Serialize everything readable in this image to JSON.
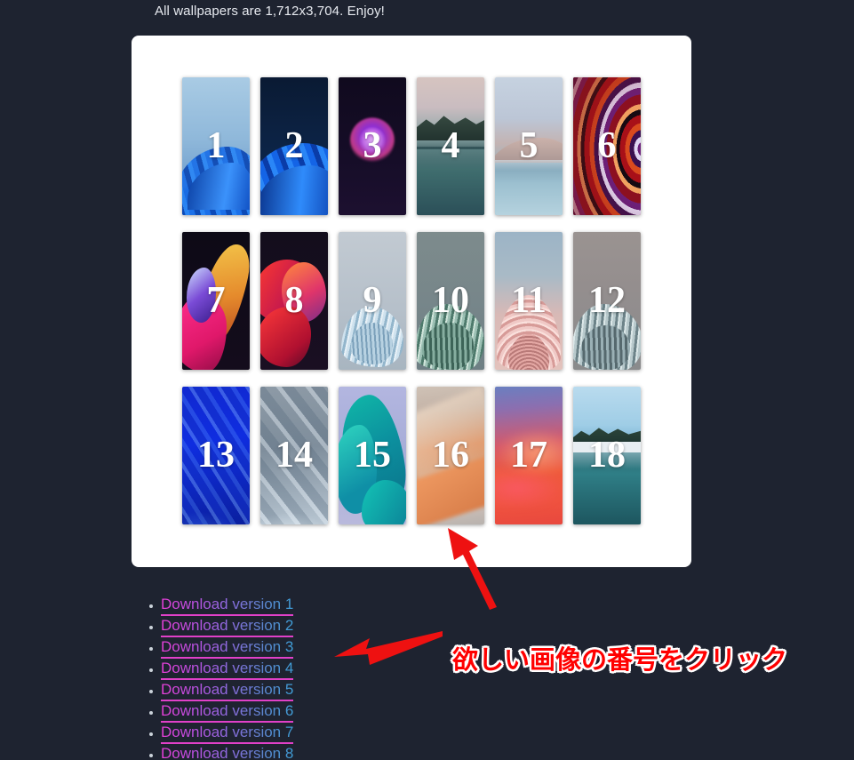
{
  "page": {
    "background_color": "#1e2330",
    "intro_text": "All wallpapers are 1,712x3,704. Enjoy!"
  },
  "card": {
    "background_color": "#ffffff"
  },
  "gallery": {
    "columns": 6,
    "rows": 3,
    "thumbnails": [
      {
        "number": "1",
        "alt": "Windows 11 blue bloom on light blue"
      },
      {
        "number": "2",
        "alt": "Windows 11 blue bloom on dark navy"
      },
      {
        "number": "3",
        "alt": "Purple glowing orb on black"
      },
      {
        "number": "4",
        "alt": "Mountain lake at dusk"
      },
      {
        "number": "5",
        "alt": "Pastel dunes and water"
      },
      {
        "number": "6",
        "alt": "Concentric red purple swirl"
      },
      {
        "number": "7",
        "alt": "Pink yellow abstract ribbons on black"
      },
      {
        "number": "8",
        "alt": "Red orange abstract flow on black"
      },
      {
        "number": "9",
        "alt": "Light blue pleated bloom on gray"
      },
      {
        "number": "10",
        "alt": "Green pleated bloom on slate"
      },
      {
        "number": "11",
        "alt": "Pink pleated bloom on blue gray"
      },
      {
        "number": "12",
        "alt": "Teal pleated bloom on warm gray"
      },
      {
        "number": "13",
        "alt": "Bright blue diagonal waves"
      },
      {
        "number": "14",
        "alt": "Silver gray diagonal waves"
      },
      {
        "number": "15",
        "alt": "Teal ribbon on lavender"
      },
      {
        "number": "16",
        "alt": "Orange and sand gradient dunes"
      },
      {
        "number": "17",
        "alt": "Red orange purple gradient blur"
      },
      {
        "number": "18",
        "alt": "Mountain lake with snow"
      }
    ]
  },
  "downloads": {
    "links": [
      {
        "label": "Download version 1"
      },
      {
        "label": "Download version 2"
      },
      {
        "label": "Download version 3"
      },
      {
        "label": "Download version 4"
      },
      {
        "label": "Download version 5"
      },
      {
        "label": "Download version 6"
      },
      {
        "label": "Download version 7"
      },
      {
        "label": "Download version 8"
      }
    ],
    "link_gradient_start": "#e83fd8",
    "link_gradient_end": "#3f9fd8",
    "underline_color": "#e040c8",
    "bullet_color": "#cbd2da"
  },
  "annotations": {
    "callout_text": "欲しい画像の番号をクリック",
    "callout_color": "#ff0000",
    "callout_outline_color": "#ffffff",
    "arrow_color": "#ee1111",
    "arrows": [
      {
        "name": "arrow-to-thumbnail-16",
        "direction": "up-left"
      },
      {
        "name": "arrow-to-download-links",
        "direction": "left"
      }
    ]
  }
}
